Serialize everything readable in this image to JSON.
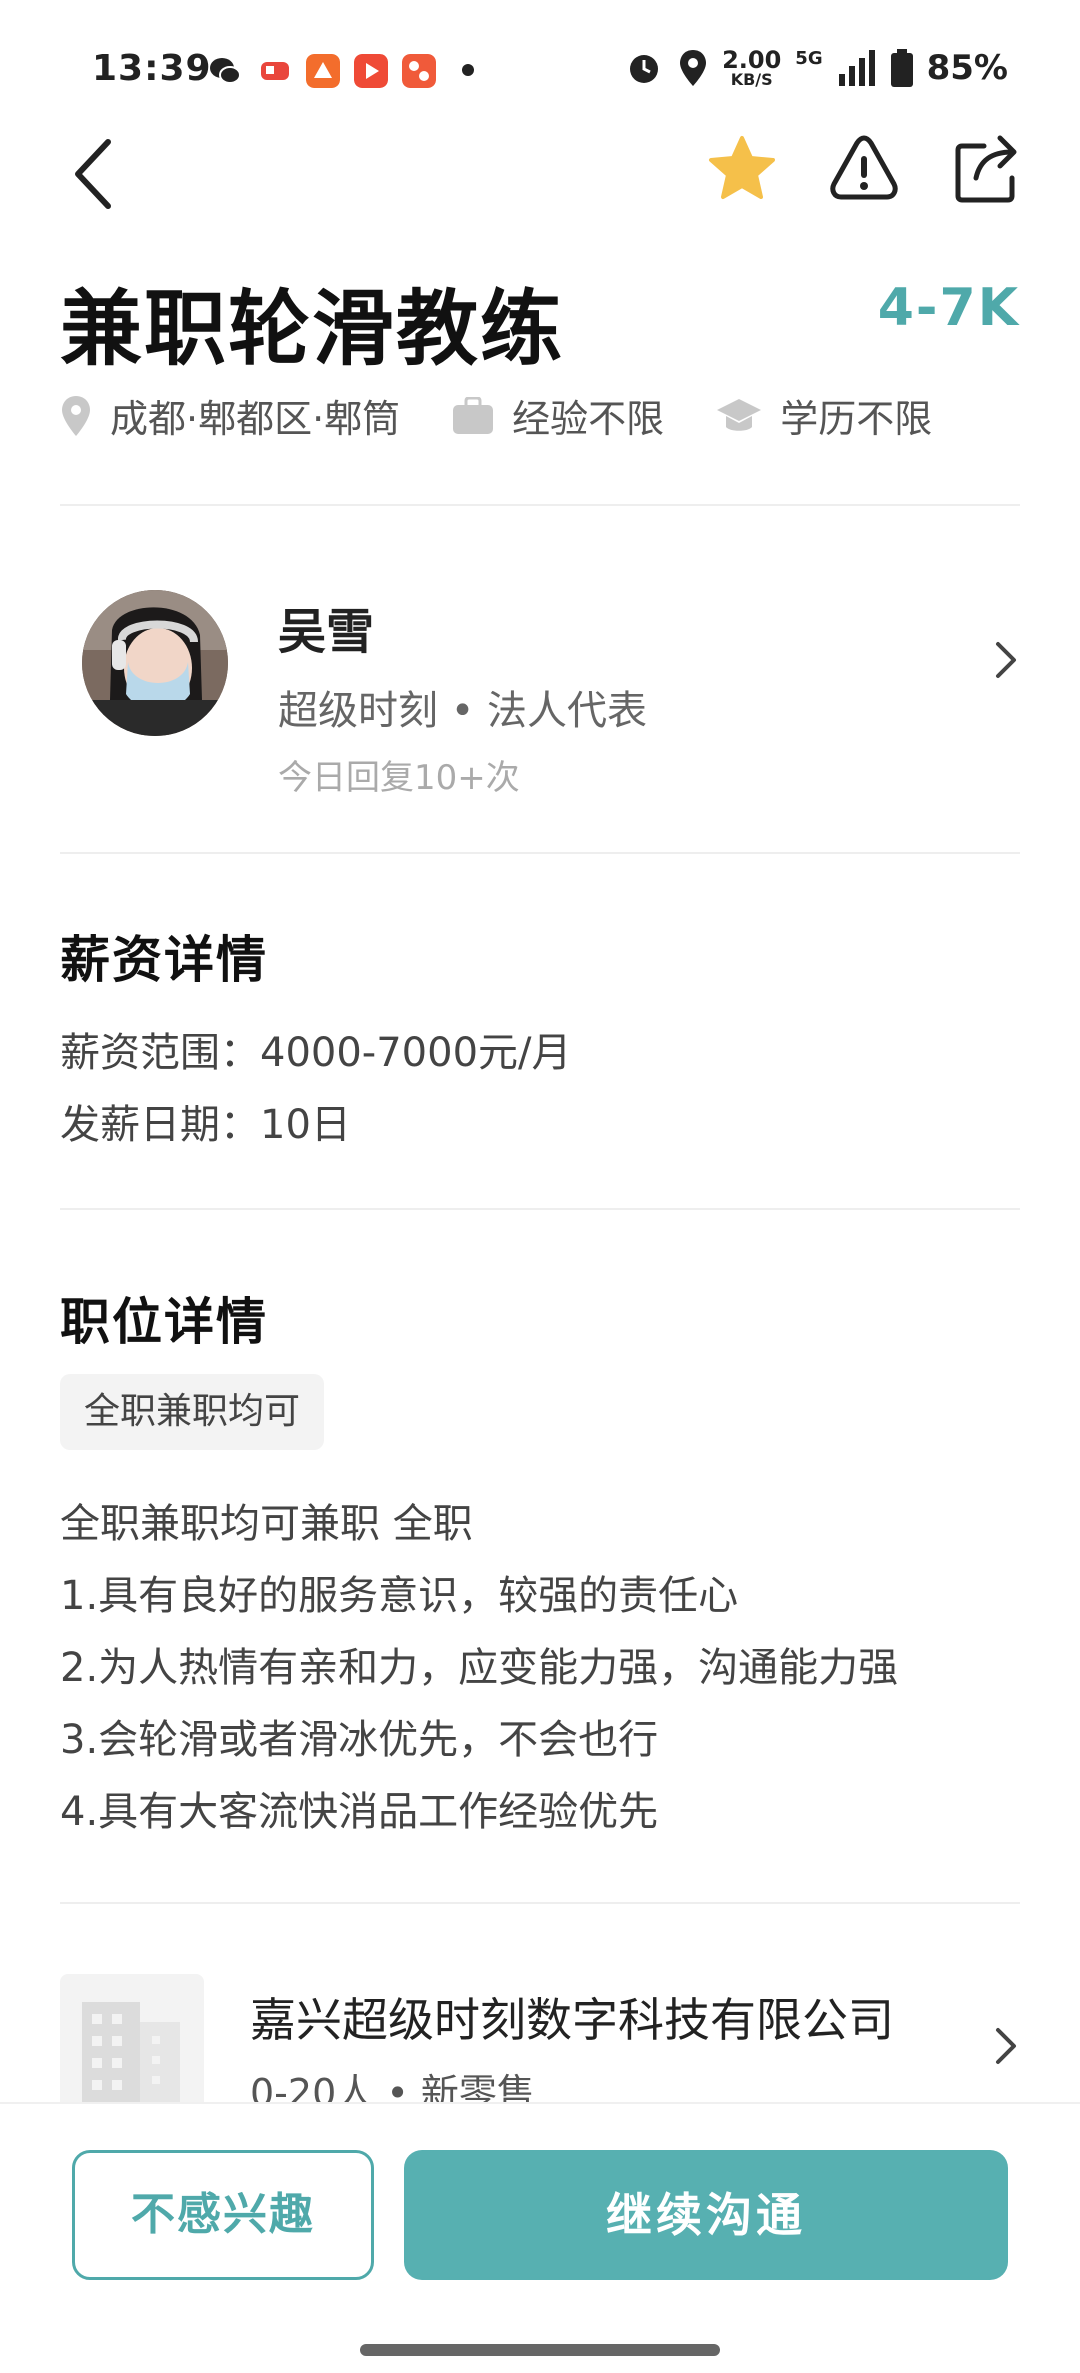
{
  "status_bar": {
    "time": "13:39",
    "net_speed_value": "2.00",
    "net_speed_unit": "KB/S",
    "network": "5G",
    "battery": "85%"
  },
  "job": {
    "title": "兼职轮滑教练",
    "salary": "4-7K",
    "location": "成都·郫都区·郫筒",
    "experience": "经验不限",
    "education": "学历不限"
  },
  "recruiter": {
    "name": "吴雪",
    "role": "超级时刻 • 法人代表",
    "reply": "今日回复10+次"
  },
  "salary_details": {
    "title": "薪资详情",
    "range": "薪资范围：4000-7000元/月",
    "payday": "发薪日期：10日"
  },
  "position_details": {
    "title": "职位详情",
    "tag": "全职兼职均可",
    "description": "全职兼职均可兼职 全职\n1.具有良好的服务意识，较强的责任心\n2.为人热情有亲和力，应变能力强，沟通能力强\n3.会轮滑或者滑冰优先，不会也行\n4.具有大客流快消品工作经验优先"
  },
  "company": {
    "name": "嘉兴超级时刻数字科技有限公司",
    "meta": "0-20人 • 新零售"
  },
  "actions": {
    "not_interested": "不感兴趣",
    "continue_chat": "继续沟通"
  },
  "colors": {
    "accent": "#4fa9aa",
    "button": "#57b0b1",
    "star": "#f5c04a"
  },
  "icons": [
    "back-arrow-icon",
    "star-icon",
    "warning-icon",
    "share-icon",
    "location-pin-icon",
    "briefcase-icon",
    "graduation-cap-icon",
    "chevron-right-icon",
    "building-icon"
  ]
}
